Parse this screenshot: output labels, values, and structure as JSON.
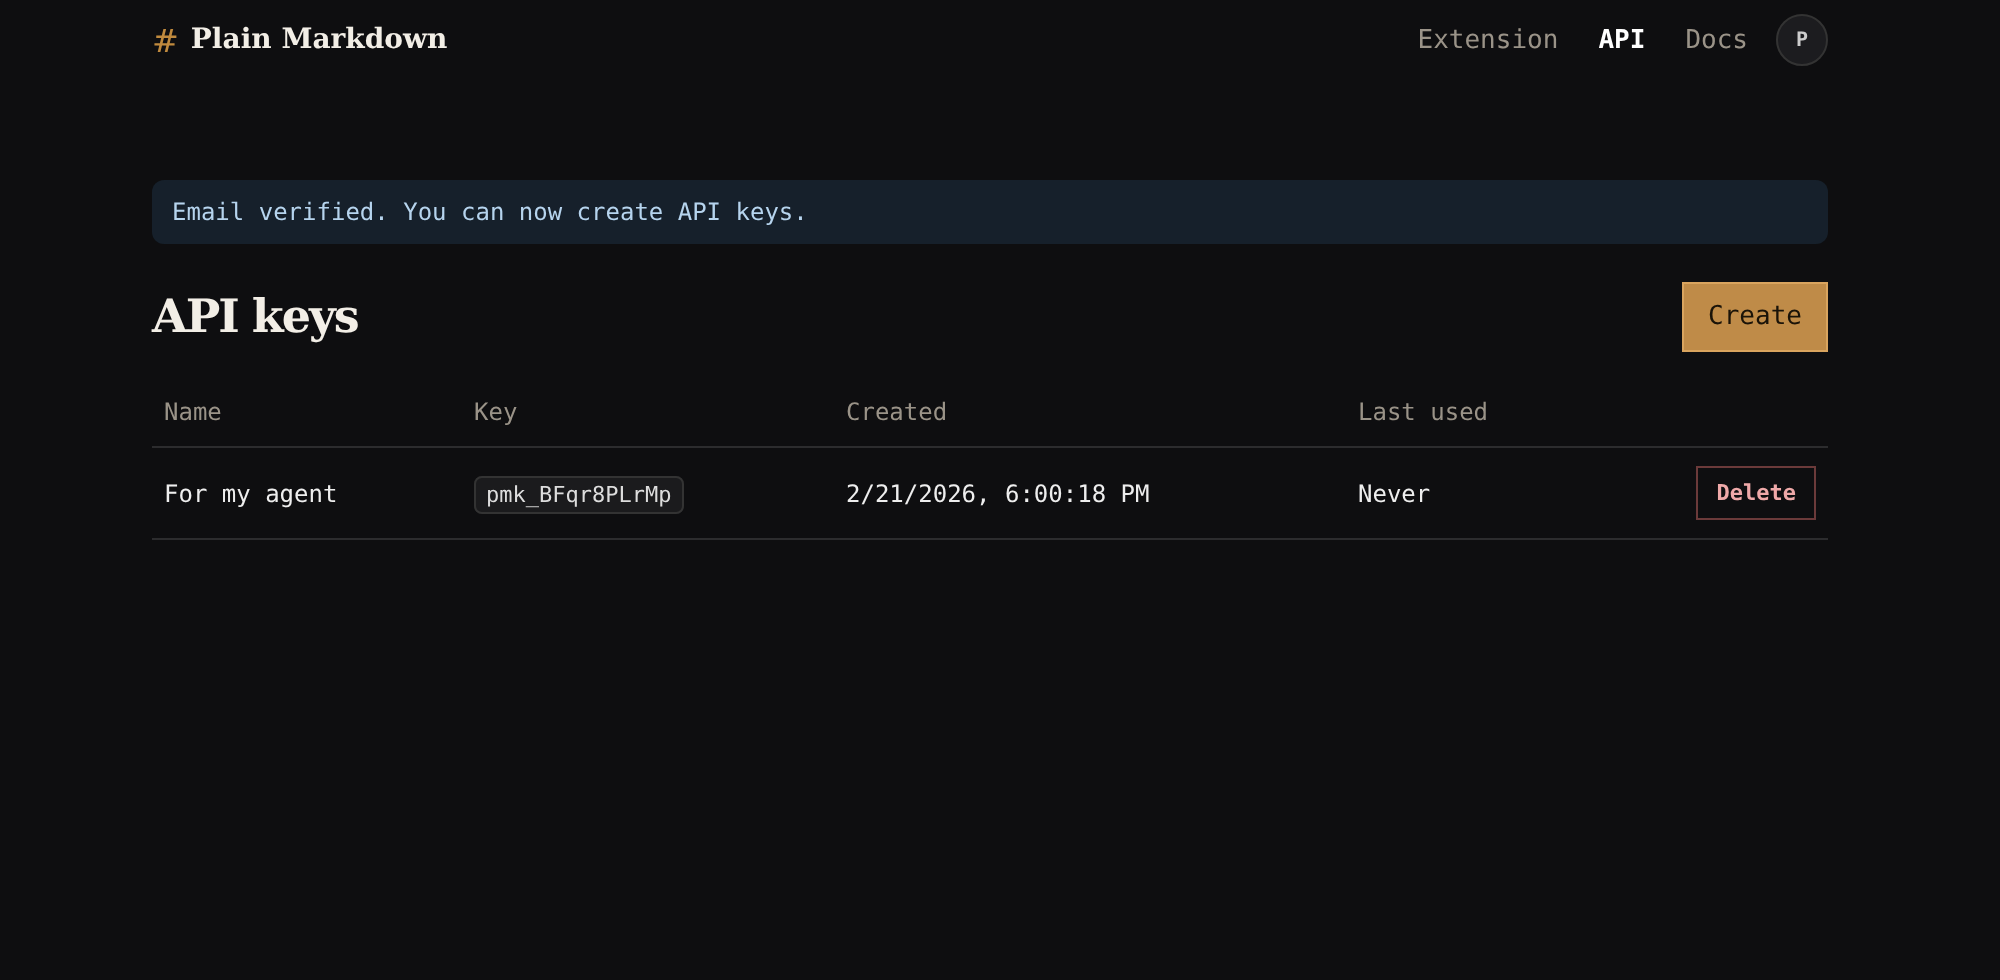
{
  "header": {
    "logo_mark": "#",
    "brand": "Plain Markdown",
    "nav": [
      {
        "label": "Extension",
        "selected": false
      },
      {
        "label": "API",
        "selected": true
      },
      {
        "label": "Docs",
        "selected": false
      }
    ],
    "avatar": "P"
  },
  "alert": "Email verified. You can now create API keys.",
  "title": "API keys",
  "create_button": "Create",
  "table": {
    "columns": [
      "Name",
      "Key",
      "Created",
      "Last used"
    ],
    "rows": [
      {
        "name": "For my agent",
        "key": "pmk_BFqr8PLrMp",
        "created": "2/21/2026, 6:00:18 PM",
        "last_used": "Never",
        "action": "Delete"
      }
    ]
  }
}
